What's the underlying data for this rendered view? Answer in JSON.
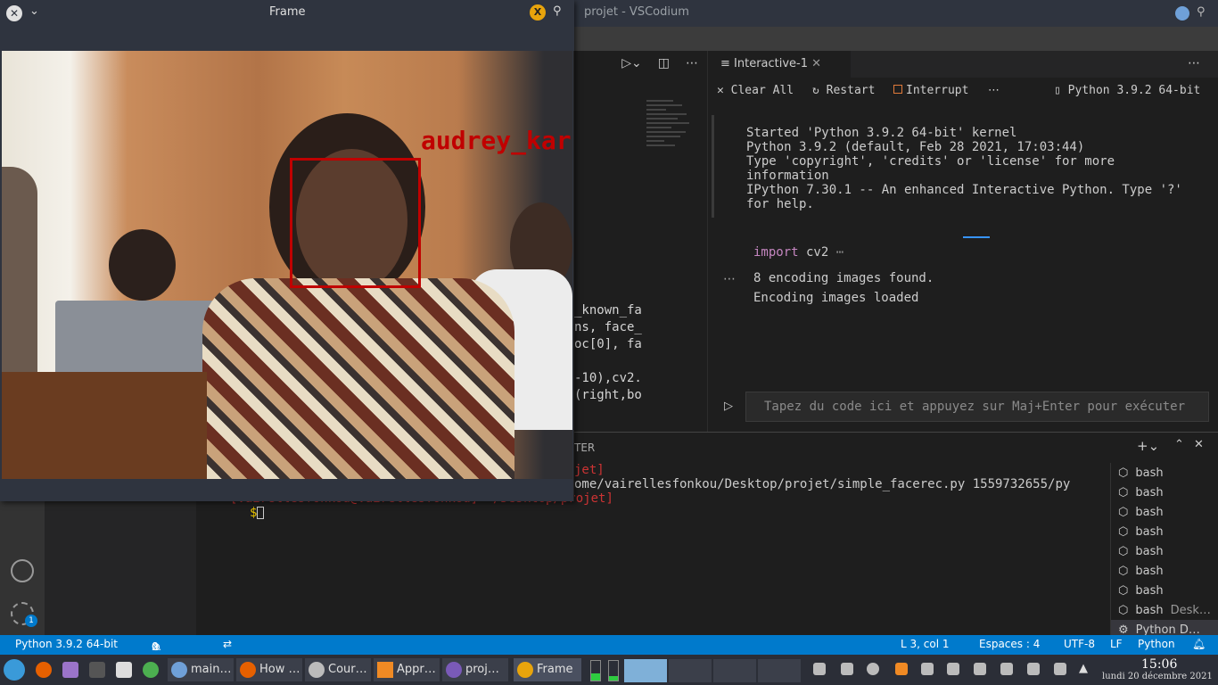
{
  "window": {
    "title": "projet - VSCodium"
  },
  "editor": {
    "code_lines": [
      "_known_fa",
      "ns, face_",
      "oc[0], fa",
      "",
      "-10),cv2.",
      "(right,bo"
    ]
  },
  "interactive": {
    "tab_label": "Interactive-1",
    "toolbar": {
      "clear_all": "Clear All",
      "restart": "Restart",
      "interrupt": "Interrupt",
      "more": "⋯",
      "kernel": "Python 3.9.2 64-bit"
    },
    "output_header": [
      "Started 'Python 3.9.2 64-bit' kernel",
      "Python 3.9.2 (default, Feb 28 2021, 17:03:44)",
      "Type 'copyright', 'credits' or 'license' for more",
      "information",
      "IPython 7.30.1 -- An enhanced Interactive Python. Type '?'",
      "for help."
    ],
    "cell_code_keyword": "import",
    "cell_code_rest": " cv2",
    "cell_code_ellipsis": "⋯",
    "cell_output": [
      "8 encoding images found.",
      "Encoding images loaded"
    ],
    "cell_gutter": "⋯",
    "input_placeholder": "Tapez du code ici et appuyez sur Maj+Enter pour exécuter"
  },
  "panel": {
    "header_fragment": "TER",
    "term_lines": [
      {
        "a": "jet]",
        "b": ""
      },
      {
        "a": "ome/vairellesfonkou/Desktop/projet/simple_facerec.py 1559732655/py",
        "b": ""
      },
      {
        "a": "[vairellesfonkou@vairellesfonkou] ",
        "b": "~/Desktop/projet]"
      },
      {
        "a": "$",
        "b": ""
      }
    ]
  },
  "terminals": [
    {
      "label": "bash",
      "detail": ""
    },
    {
      "label": "bash",
      "detail": ""
    },
    {
      "label": "bash",
      "detail": ""
    },
    {
      "label": "bash",
      "detail": ""
    },
    {
      "label": "bash",
      "detail": ""
    },
    {
      "label": "bash",
      "detail": ""
    },
    {
      "label": "bash",
      "detail": ""
    },
    {
      "label": "bash",
      "detail": "Desk…"
    },
    {
      "label": "Python D…",
      "detail": ""
    }
  ],
  "statusbar": {
    "interpreter": "Python 3.9.2 64-bit",
    "errors": "0",
    "warnings": "0",
    "position": "L 3, col 1",
    "indent": "Espaces : 4",
    "encoding": "UTF-8",
    "eol": "LF",
    "language": "Python"
  },
  "activity": {
    "settings_badge": "1"
  },
  "frame": {
    "title": "Frame",
    "face_label": "audrey_kar",
    "box_color": "#c00000"
  },
  "taskbar": {
    "tasks": [
      "main…",
      "How …",
      "Cour…",
      "Appr…",
      "proj…",
      "Frame"
    ],
    "clock_time": "15:06",
    "clock_date": "lundi 20 décembre 2021"
  },
  "colors": {
    "accent": "#007acc",
    "face_box": "#c00000"
  }
}
